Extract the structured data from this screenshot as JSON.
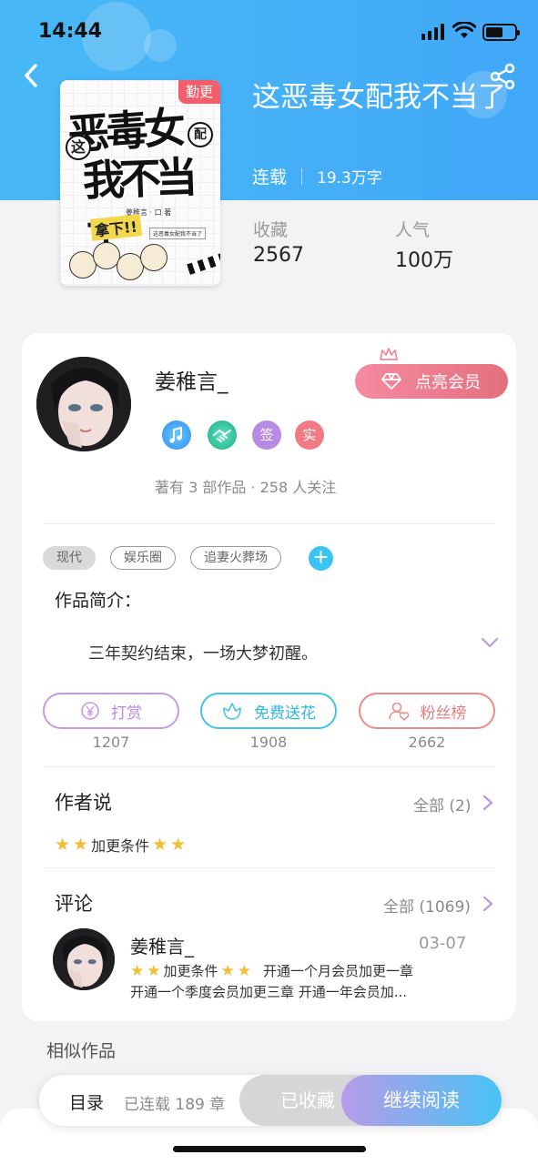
{
  "status_bar": {
    "time": "14:44"
  },
  "book": {
    "badge": "勤更",
    "title": "这恶毒女配我不当了",
    "status": "连载",
    "words": "19.3万字",
    "cover_text": {
      "title_line1": "恶毒女",
      "title_line2": "我不当了",
      "bubble_left": "这",
      "bubble_right": "配",
      "author_small": "姜稚言 · 口 著",
      "sub": "这恶毒女配我不当了",
      "slogan": "拿下!!"
    },
    "stats": [
      {
        "label": "收藏",
        "value": "2567"
      },
      {
        "label": "人气",
        "value": "100万"
      }
    ]
  },
  "author": {
    "name": "姜稚言_",
    "vip_button": "点亮会员",
    "badges": [
      {
        "icon": "music-note-icon",
        "text": "",
        "color": "#3ea8f2"
      },
      {
        "icon": "handshake-icon",
        "text": "",
        "color": "#2ebd9a"
      },
      {
        "icon": "sign-badge-icon",
        "text": "签",
        "color": "#b78be4"
      },
      {
        "icon": "real-name-badge-icon",
        "text": "实",
        "color": "#f27a84"
      }
    ],
    "summary": "著有 3 部作品 · 258 人关注"
  },
  "tags": [
    "现代",
    "娱乐圈",
    "追妻火葬场"
  ],
  "intro": {
    "label": "作品简介：",
    "text": "三年契约结束，一场大梦初醒。"
  },
  "actions": [
    {
      "label": "打赏",
      "count": "1207",
      "color": "#c79ae8"
    },
    {
      "label": "免费送花",
      "count": "1908",
      "color": "#41c3ef"
    },
    {
      "label": "粉丝榜",
      "count": "2662",
      "color": "#ef8a8a"
    }
  ],
  "author_says": {
    "title": "作者说",
    "more": "全部 (2)",
    "content": "加更条件"
  },
  "comments": {
    "title": "评论",
    "more": "全部 (1069)",
    "item": {
      "name": "姜稚言_",
      "date": "03-07",
      "line1_prefix": "加更条件",
      "line1_suffix": "开通一个月会员加更一章",
      "line2": "开通一个季度会员加更三章  开通一年会员加..."
    }
  },
  "similar": {
    "title": "相似作品"
  },
  "bottom_bar": {
    "toc": "目录",
    "chapters": "已连载 189 章",
    "collected": "已收藏",
    "read": "继续阅读"
  },
  "colors": {
    "hero": "#41a8f8",
    "accent": "#39c4f5",
    "vip": "#e4707d"
  }
}
